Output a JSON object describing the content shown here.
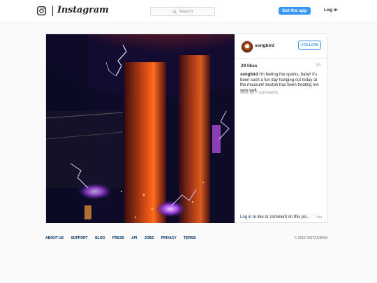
{
  "header": {
    "wordmark": "Instagram",
    "search_placeholder": "Search",
    "get_app_label": "Get the app",
    "login_label": "Log in",
    "icons": [
      "instagram-camera-icon",
      "search-icon"
    ]
  },
  "post": {
    "username": "songbird",
    "follow_label": "FOLLOW",
    "likes": "29 likes",
    "time_ago": "2h",
    "caption_user": "songbird",
    "caption_text": " i'm feeling the sparks, baby! it's been such a fun day hanging out today at the museum! boston has been treating me very well.",
    "view_comments": "view all 7 comments",
    "login_link": "Log in",
    "login_rest": " to like or comment on this po...",
    "more_glyph": "•••",
    "image_icon": "tesla-coil-photo"
  },
  "footer": {
    "links": [
      "ABOUT US",
      "SUPPORT",
      "BLOG",
      "PRESS",
      "API",
      "JOBS",
      "PRIVACY",
      "TERMS"
    ],
    "copyright": "© 2016 INSTAGRAM"
  },
  "colors": {
    "accent": "#3897f0",
    "link": "#003569",
    "background": "#fafafa"
  }
}
